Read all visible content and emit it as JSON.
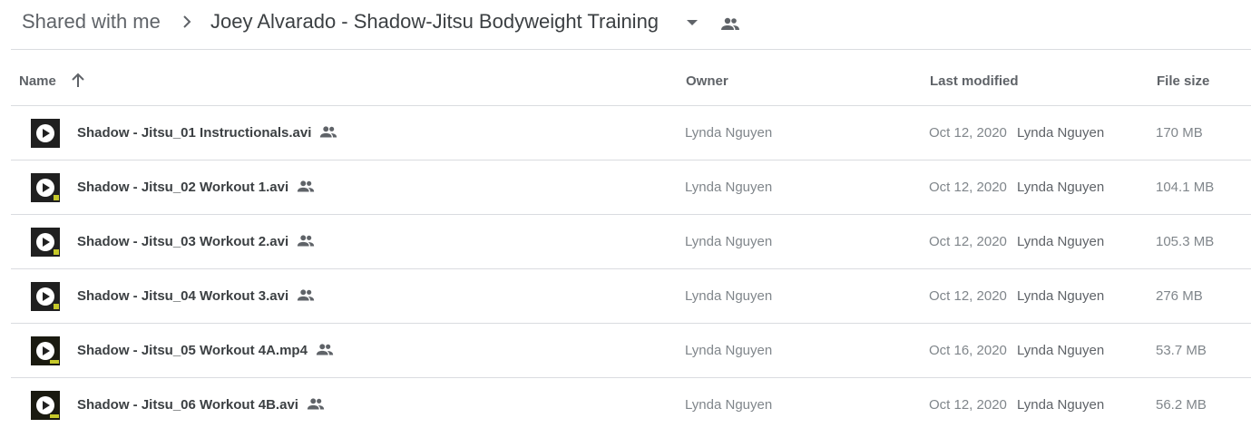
{
  "breadcrumb": {
    "root": "Shared with me",
    "separator_icon": "chevron-right-icon",
    "current": "Joey Alvarado - Shadow-Jitsu Bodyweight Training",
    "caret_icon": "arrow-drop-down-icon",
    "shared_icon": "people-icon"
  },
  "columns": {
    "name": "Name",
    "sort_icon": "arrow-up-icon",
    "owner": "Owner",
    "last_modified": "Last modified",
    "file_size": "File size"
  },
  "files": [
    {
      "name": "Shadow - Jitsu_01 Instructionals.avi",
      "owner": "Lynda Nguyen",
      "modified_date": "Oct 12, 2020",
      "modified_by": "Lynda Nguyen",
      "size": "170 MB"
    },
    {
      "name": "Shadow - Jitsu_02 Workout 1.avi",
      "owner": "Lynda Nguyen",
      "modified_date": "Oct 12, 2020",
      "modified_by": "Lynda Nguyen",
      "size": "104.1 MB"
    },
    {
      "name": "Shadow - Jitsu_03 Workout 2.avi",
      "owner": "Lynda Nguyen",
      "modified_date": "Oct 12, 2020",
      "modified_by": "Lynda Nguyen",
      "size": "105.3 MB"
    },
    {
      "name": "Shadow - Jitsu_04 Workout 3.avi",
      "owner": "Lynda Nguyen",
      "modified_date": "Oct 12, 2020",
      "modified_by": "Lynda Nguyen",
      "size": "276 MB"
    },
    {
      "name": "Shadow - Jitsu_05 Workout 4A.mp4",
      "owner": "Lynda Nguyen",
      "modified_date": "Oct 16, 2020",
      "modified_by": "Lynda Nguyen",
      "size": "53.7 MB"
    },
    {
      "name": "Shadow - Jitsu_06 Workout 4B.avi",
      "owner": "Lynda Nguyen",
      "modified_date": "Oct 12, 2020",
      "modified_by": "Lynda Nguyen",
      "size": "56.2 MB"
    }
  ],
  "colors": {
    "text_primary": "#3c4043",
    "text_secondary": "#5f6368",
    "text_muted": "#80868b",
    "divider": "#dadce0"
  }
}
